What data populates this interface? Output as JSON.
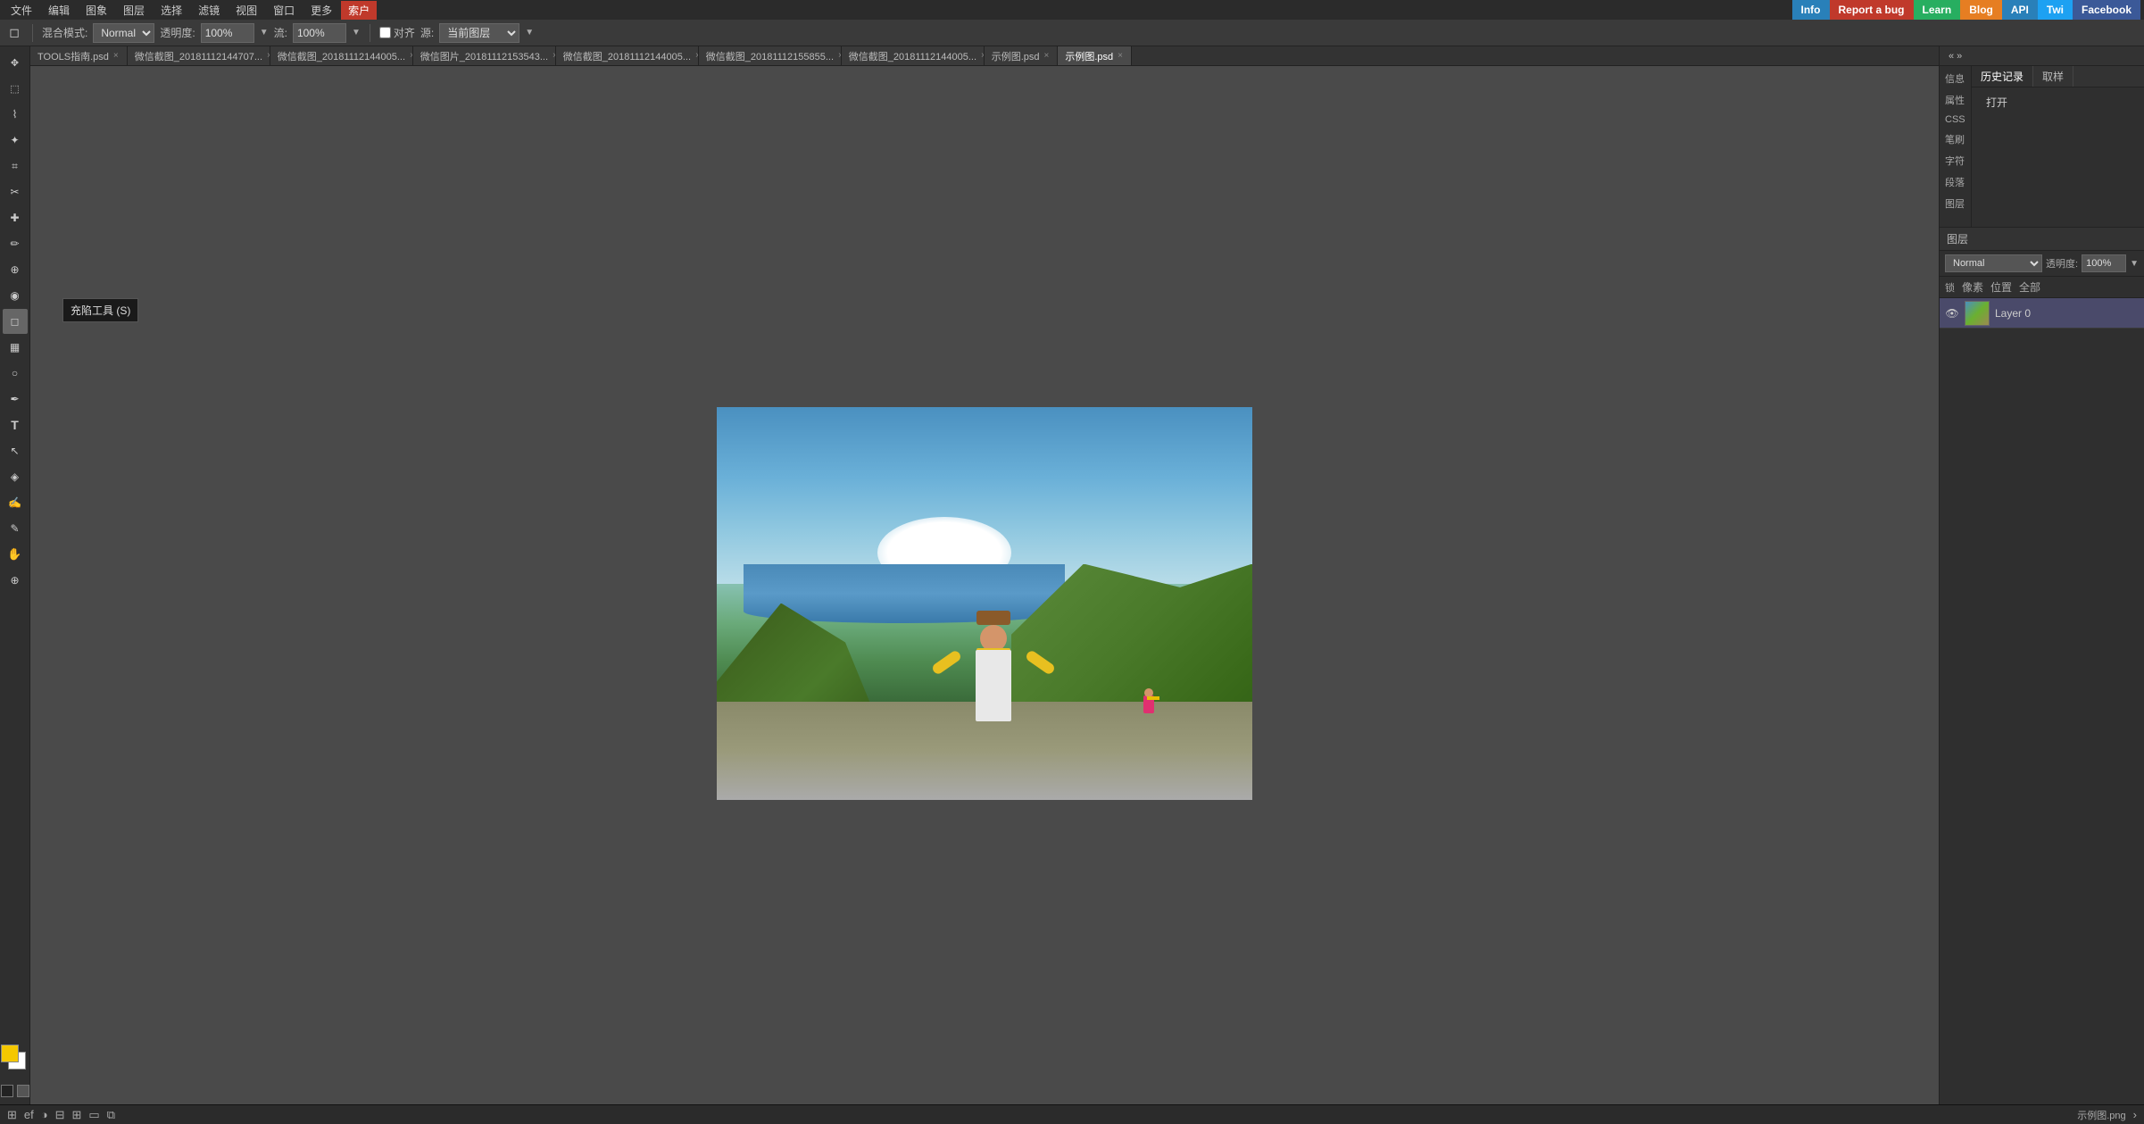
{
  "topMenu": {
    "items": [
      "文件",
      "编辑",
      "图象",
      "图层",
      "选择",
      "滤镜",
      "视图",
      "窗口",
      "更多",
      "索户"
    ],
    "activeItem": "索户"
  },
  "topButtons": {
    "info": "Info",
    "reportBug": "Report a bug",
    "learn": "Learn",
    "blog": "Blog",
    "api": "API",
    "twi": "Twi",
    "facebook": "Facebook"
  },
  "optionsBar": {
    "blendModeLabel": "混合模式:",
    "blendMode": "Normal",
    "opacityLabel": "透明度:",
    "opacity": "100%",
    "flowLabel": "流:",
    "flow": "100%",
    "alignLabel": "对齐",
    "sourceLabel": "源:",
    "source": "当前图层",
    "arrowOptions": [
      "▼",
      "▼",
      "▼"
    ]
  },
  "tabs": [
    {
      "name": "TOOLS指南.psd",
      "active": false,
      "closable": true
    },
    {
      "name": "微信截图_20181112144707...",
      "active": false,
      "closable": true
    },
    {
      "name": "微信截图_20181112144005...",
      "active": false,
      "closable": true
    },
    {
      "name": "微信图片_20181112153543...",
      "active": false,
      "closable": true
    },
    {
      "name": "微信截图_20181112144005...",
      "active": false,
      "closable": true
    },
    {
      "name": "微信截图_20181112155855...",
      "active": false,
      "closable": true
    },
    {
      "name": "微信截图_20181112144005...",
      "active": false,
      "closable": true
    },
    {
      "name": "示例图.psd",
      "active": false,
      "closable": true
    },
    {
      "name": "示例图.psd",
      "active": true,
      "closable": true
    }
  ],
  "leftToolbar": {
    "tools": [
      {
        "id": "move",
        "icon": "✥",
        "tooltip": ""
      },
      {
        "id": "select-rect",
        "icon": "⬜",
        "tooltip": ""
      },
      {
        "id": "lasso",
        "icon": "⌇",
        "tooltip": ""
      },
      {
        "id": "magic-wand",
        "icon": "✦",
        "tooltip": ""
      },
      {
        "id": "crop",
        "icon": "⌗",
        "tooltip": ""
      },
      {
        "id": "slice",
        "icon": "⊘",
        "tooltip": ""
      },
      {
        "id": "heal",
        "icon": "✚",
        "tooltip": ""
      },
      {
        "id": "brush",
        "icon": "✏",
        "tooltip": ""
      },
      {
        "id": "clone",
        "icon": "⊕",
        "tooltip": ""
      },
      {
        "id": "history",
        "icon": "◉",
        "tooltip": ""
      },
      {
        "id": "eraser",
        "icon": "◻",
        "tooltip": "充陷工具 (S)"
      },
      {
        "id": "gradient",
        "icon": "▦",
        "tooltip": ""
      },
      {
        "id": "dodge",
        "icon": "○",
        "tooltip": ""
      },
      {
        "id": "pen",
        "icon": "✒",
        "tooltip": ""
      },
      {
        "id": "text",
        "icon": "T",
        "tooltip": ""
      },
      {
        "id": "path-select",
        "icon": "↖",
        "tooltip": ""
      },
      {
        "id": "shape",
        "icon": "◈",
        "tooltip": ""
      },
      {
        "id": "eyedropper",
        "icon": "✍",
        "tooltip": ""
      },
      {
        "id": "note",
        "icon": "✎",
        "tooltip": ""
      },
      {
        "id": "hand",
        "icon": "✋",
        "tooltip": ""
      },
      {
        "id": "zoom",
        "icon": "🔍",
        "tooltip": ""
      }
    ]
  },
  "rightPanel": {
    "tabs": [
      "历史记录",
      "取样"
    ],
    "activeTab": "历史记录",
    "properties": {
      "infoLabel": "信息",
      "propsLabel": "属性",
      "propsValue": "打开",
      "cssLabel": "CSS",
      "brushLabel": "笔刷",
      "charLabel": "字符",
      "paraLabel": "段落",
      "layersLabel": "图层"
    }
  },
  "layersPanel": {
    "header": "图层",
    "blendMode": "Normal",
    "opacity": "透明度: 100%",
    "lockItems": [
      "锁",
      "像素",
      "位置",
      "全部"
    ],
    "layers": [
      {
        "name": "Layer 0",
        "visible": true,
        "active": true
      }
    ]
  },
  "statusBar": {
    "fileInfo": "示例图.png",
    "icons": [
      "⊞",
      "ef",
      "◑",
      "⊟",
      "⊞",
      "▭",
      "⧉"
    ],
    "arrow": "›"
  },
  "tooltip": {
    "text": "充陷工具 (S)"
  }
}
